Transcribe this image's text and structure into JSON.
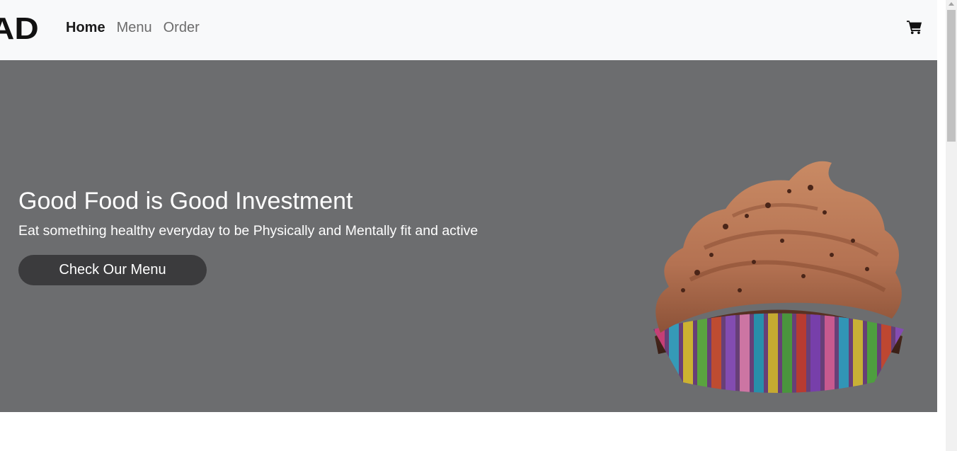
{
  "navbar": {
    "brand": "AD",
    "links": [
      {
        "label": "Home",
        "active": true
      },
      {
        "label": "Menu",
        "active": false
      },
      {
        "label": "Order",
        "active": false
      }
    ],
    "cart_icon": "shopping-cart-icon"
  },
  "hero": {
    "title": "Good Food is Good Investment",
    "subtitle": "Eat something healthy everyday to be Physically and Mentally fit and active",
    "button_label": "Check Our Menu",
    "image": "chocolate-cupcake-image"
  },
  "colors": {
    "navbar_bg": "#f8f9fa",
    "hero_bg": "#6c6d6f",
    "button_bg": "#3b3b3d",
    "text_light": "#ffffff",
    "nav_active": "#1b1b1b",
    "nav_inactive": "#6c6c6c"
  }
}
